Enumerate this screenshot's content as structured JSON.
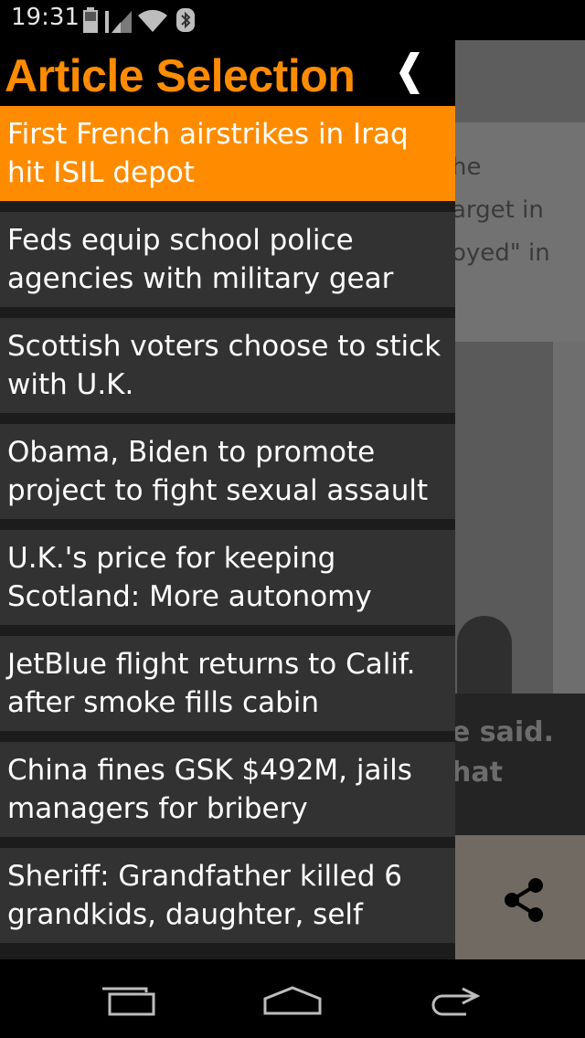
{
  "status_bar": {
    "time": "19:31",
    "icons": [
      "battery-icon",
      "signal-icon",
      "wifi-icon",
      "bluetooth-icon"
    ]
  },
  "drawer": {
    "title": "Article Selection",
    "back_icon": "chevron-left-icon",
    "accent_color": "#ff8c00",
    "selected_index": 0,
    "items": [
      {
        "label": "First French airstrikes in Iraq hit ISIL depot"
      },
      {
        "label": "Feds equip school police agencies with military gear"
      },
      {
        "label": "Scottish voters choose to stick with U.K."
      },
      {
        "label": "Obama, Biden to promote project to fight sexual assault"
      },
      {
        "label": "U.K.'s price for keeping Scotland: More autonomy"
      },
      {
        "label": "JetBlue flight returns to Calif. after smoke fills cabin"
      },
      {
        "label": "China fines GSK $492M, jails managers for bribery"
      },
      {
        "label": "Sheriff: Grandfather killed 6 grandkids, daughter, self"
      }
    ]
  },
  "background_article": {
    "text_lines": [
      "he",
      "arget in",
      "oyed\" in"
    ],
    "caption_lines": [
      "e said.",
      "hat"
    ],
    "share_icon": "share-icon"
  },
  "nav_bar": {
    "buttons": [
      "recent-apps-icon",
      "home-icon",
      "back-icon"
    ]
  }
}
